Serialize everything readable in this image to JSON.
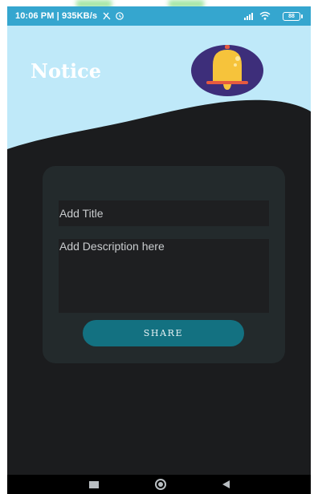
{
  "status_bar": {
    "left_text": "10:06 PM | 935KB/s",
    "battery": "88"
  },
  "header": {
    "title": "Notice",
    "icon": "bell-icon"
  },
  "form": {
    "title_placeholder": "Add Title",
    "description_placeholder": "Add Description here",
    "share_label": "SHARE"
  },
  "navigation": {
    "recents_icon": "recents-icon",
    "home_icon": "home-icon",
    "back_icon": "back-icon"
  },
  "colors": {
    "header_background": "#bfe9f9",
    "status_bar": "#35a6cf",
    "page_background": "#1b1c1e",
    "card_background": "#232a2c",
    "share_button": "#137181"
  }
}
